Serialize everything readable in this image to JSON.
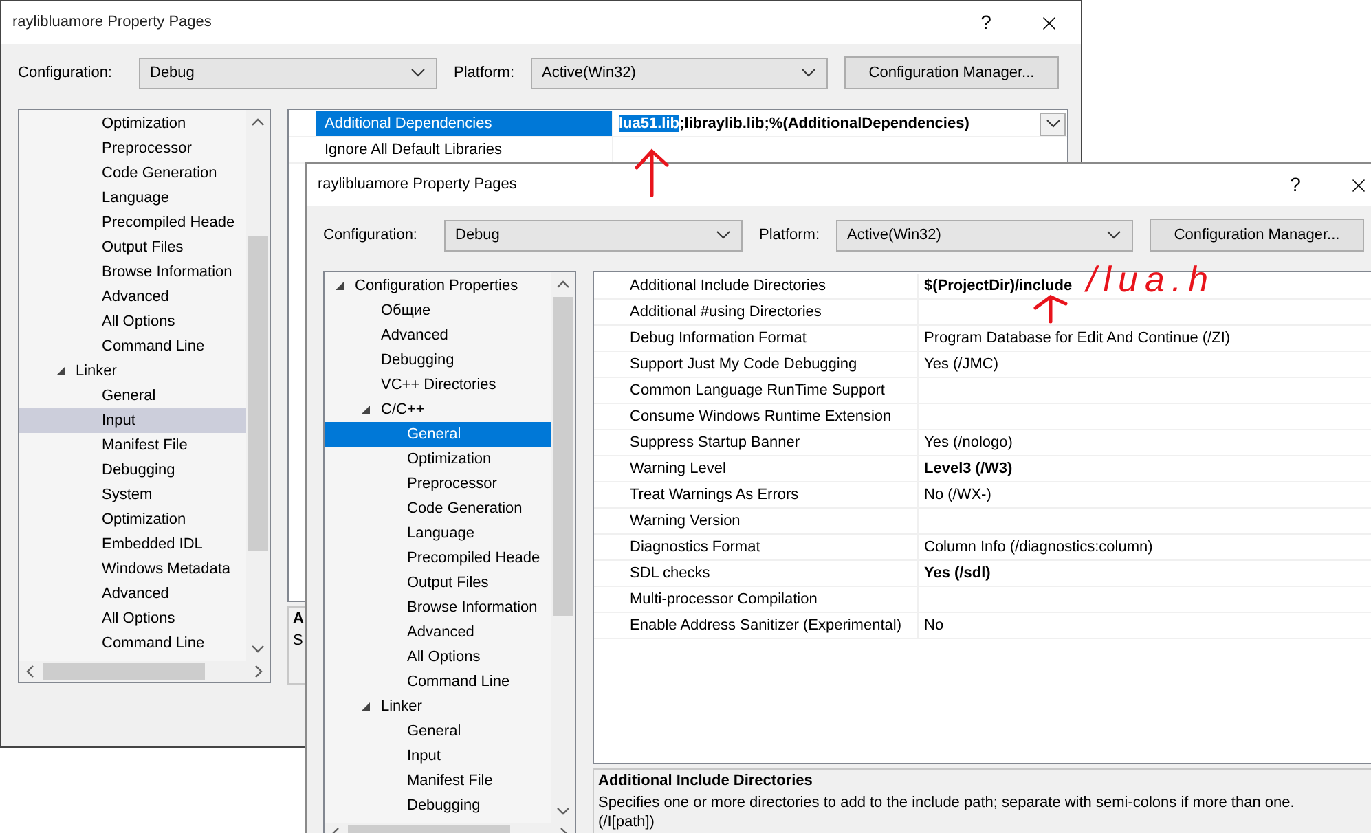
{
  "windows": [
    {
      "title": "raylibluamore Property Pages",
      "active": false,
      "help": "?",
      "configuration_label": "Configuration:",
      "configuration": "Debug",
      "platform_label": "Platform:",
      "platform": "Active(Win32)",
      "manager_button": "Configuration Manager...",
      "tree": [
        {
          "children": [
            {
              "children": [
                {
                  "label": "Optimization",
                  "selected": false
                },
                {
                  "label": "Preprocessor",
                  "selected": false
                },
                {
                  "label": "Code Generation",
                  "selected": false
                },
                {
                  "label": "Language",
                  "selected": false
                },
                {
                  "label": "Precompiled Heade",
                  "selected": false
                },
                {
                  "label": "Output Files",
                  "selected": false
                },
                {
                  "label": "Browse Information",
                  "selected": false
                },
                {
                  "label": "Advanced",
                  "selected": false
                },
                {
                  "label": "All Options",
                  "selected": false
                },
                {
                  "label": "Command Line",
                  "selected": false
                }
              ]
            },
            {
              "label": "Linker",
              "expanded": true,
              "selected": false,
              "children": [
                {
                  "label": "General",
                  "selected": false
                },
                {
                  "label": "Input",
                  "selected": true
                },
                {
                  "label": "Manifest File",
                  "selected": false
                },
                {
                  "label": "Debugging",
                  "selected": false
                },
                {
                  "label": "System",
                  "selected": false
                },
                {
                  "label": "Optimization",
                  "selected": false
                },
                {
                  "label": "Embedded IDL",
                  "selected": false
                },
                {
                  "label": "Windows Metadata",
                  "selected": false
                },
                {
                  "label": "Advanced",
                  "selected": false
                },
                {
                  "label": "All Options",
                  "selected": false
                },
                {
                  "label": "Command Line",
                  "selected": false
                }
              ]
            }
          ]
        }
      ],
      "properties": [
        {
          "label": "Additional Dependencies",
          "kind": "dropdown",
          "selected": true,
          "bold": true,
          "value_parts": [
            {
              "text": "lua51.lib",
              "selected": true
            },
            {
              "text": ";libraylib.lib;%(AdditionalDependencies)",
              "selected": false
            }
          ]
        },
        {
          "label": "Ignore All Default Libraries",
          "kind": "text",
          "selected": false
        }
      ],
      "description": {
        "title": "A",
        "text": "S"
      }
    },
    {
      "title": "raylibluamore Property Pages",
      "active": true,
      "help": "?",
      "configuration_label": "Configuration:",
      "configuration": "Debug",
      "platform_label": "Platform:",
      "platform": "Active(Win32)",
      "manager_button": "Configuration Manager...",
      "tree": [
        {
          "label": "Configuration Properties",
          "expanded": true,
          "selected": false,
          "children": [
            {
              "label": "Общие",
              "selected": false
            },
            {
              "label": "Advanced",
              "selected": false
            },
            {
              "label": "Debugging",
              "selected": false
            },
            {
              "label": "VC++ Directories",
              "selected": false
            },
            {
              "label": "C/C++",
              "expanded": true,
              "selected": false,
              "children": [
                {
                  "label": "General",
                  "selected": true
                },
                {
                  "label": "Optimization",
                  "selected": false
                },
                {
                  "label": "Preprocessor",
                  "selected": false
                },
                {
                  "label": "Code Generation",
                  "selected": false
                },
                {
                  "label": "Language",
                  "selected": false
                },
                {
                  "label": "Precompiled Heade",
                  "selected": false
                },
                {
                  "label": "Output Files",
                  "selected": false
                },
                {
                  "label": "Browse Information",
                  "selected": false
                },
                {
                  "label": "Advanced",
                  "selected": false
                },
                {
                  "label": "All Options",
                  "selected": false
                },
                {
                  "label": "Command Line",
                  "selected": false
                }
              ]
            },
            {
              "label": "Linker",
              "expanded": true,
              "selected": false,
              "children": [
                {
                  "label": "General",
                  "selected": false
                },
                {
                  "label": "Input",
                  "selected": false
                },
                {
                  "label": "Manifest File",
                  "selected": false
                },
                {
                  "label": "Debugging",
                  "selected": false
                }
              ]
            }
          ]
        }
      ],
      "properties": [
        {
          "label": "Additional Include Directories",
          "kind": "text",
          "selected": false,
          "bold": true,
          "value_parts": [
            {
              "text": "$(ProjectDir)/include",
              "selected": false
            }
          ]
        },
        {
          "label": "Additional #using Directories",
          "kind": "text",
          "selected": false
        },
        {
          "label": "Debug Information Format",
          "kind": "text",
          "selected": false,
          "bold": false,
          "value_parts": [
            {
              "text": "Program Database for Edit And Continue (/ZI)",
              "selected": false
            }
          ]
        },
        {
          "label": "Support Just My Code Debugging",
          "kind": "text",
          "selected": false,
          "bold": false,
          "value_parts": [
            {
              "text": "Yes (/JMC)",
              "selected": false
            }
          ]
        },
        {
          "label": "Common Language RunTime Support",
          "kind": "text",
          "selected": false
        },
        {
          "label": "Consume Windows Runtime Extension",
          "kind": "text",
          "selected": false
        },
        {
          "label": "Suppress Startup Banner",
          "kind": "text",
          "selected": false,
          "bold": false,
          "value_parts": [
            {
              "text": "Yes (/nologo)",
              "selected": false
            }
          ]
        },
        {
          "label": "Warning Level",
          "kind": "text",
          "selected": false,
          "bold": true,
          "value_parts": [
            {
              "text": "Level3 (/W3)",
              "selected": false
            }
          ]
        },
        {
          "label": "Treat Warnings As Errors",
          "kind": "text",
          "selected": false,
          "bold": false,
          "value_parts": [
            {
              "text": "No (/WX-)",
              "selected": false
            }
          ]
        },
        {
          "label": "Warning Version",
          "kind": "text",
          "selected": false
        },
        {
          "label": "Diagnostics Format",
          "kind": "text",
          "selected": false,
          "bold": false,
          "value_parts": [
            {
              "text": "Column Info (/diagnostics:column)",
              "selected": false
            }
          ]
        },
        {
          "label": "SDL checks",
          "kind": "text",
          "selected": false,
          "bold": true,
          "value_parts": [
            {
              "text": "Yes (/sdl)",
              "selected": false
            }
          ]
        },
        {
          "label": "Multi-processor Compilation",
          "kind": "text",
          "selected": false
        },
        {
          "label": "Enable Address Sanitizer (Experimental)",
          "kind": "text",
          "selected": false,
          "bold": false,
          "value_parts": [
            {
              "text": "No",
              "selected": false
            }
          ]
        }
      ],
      "description": {
        "title": "Additional Include Directories",
        "text": "Specifies one or more directories to add to the include path; separate with semi-colons if more than one. (/I[path])"
      }
    }
  ],
  "annotation": {
    "text": "/lua.h"
  }
}
